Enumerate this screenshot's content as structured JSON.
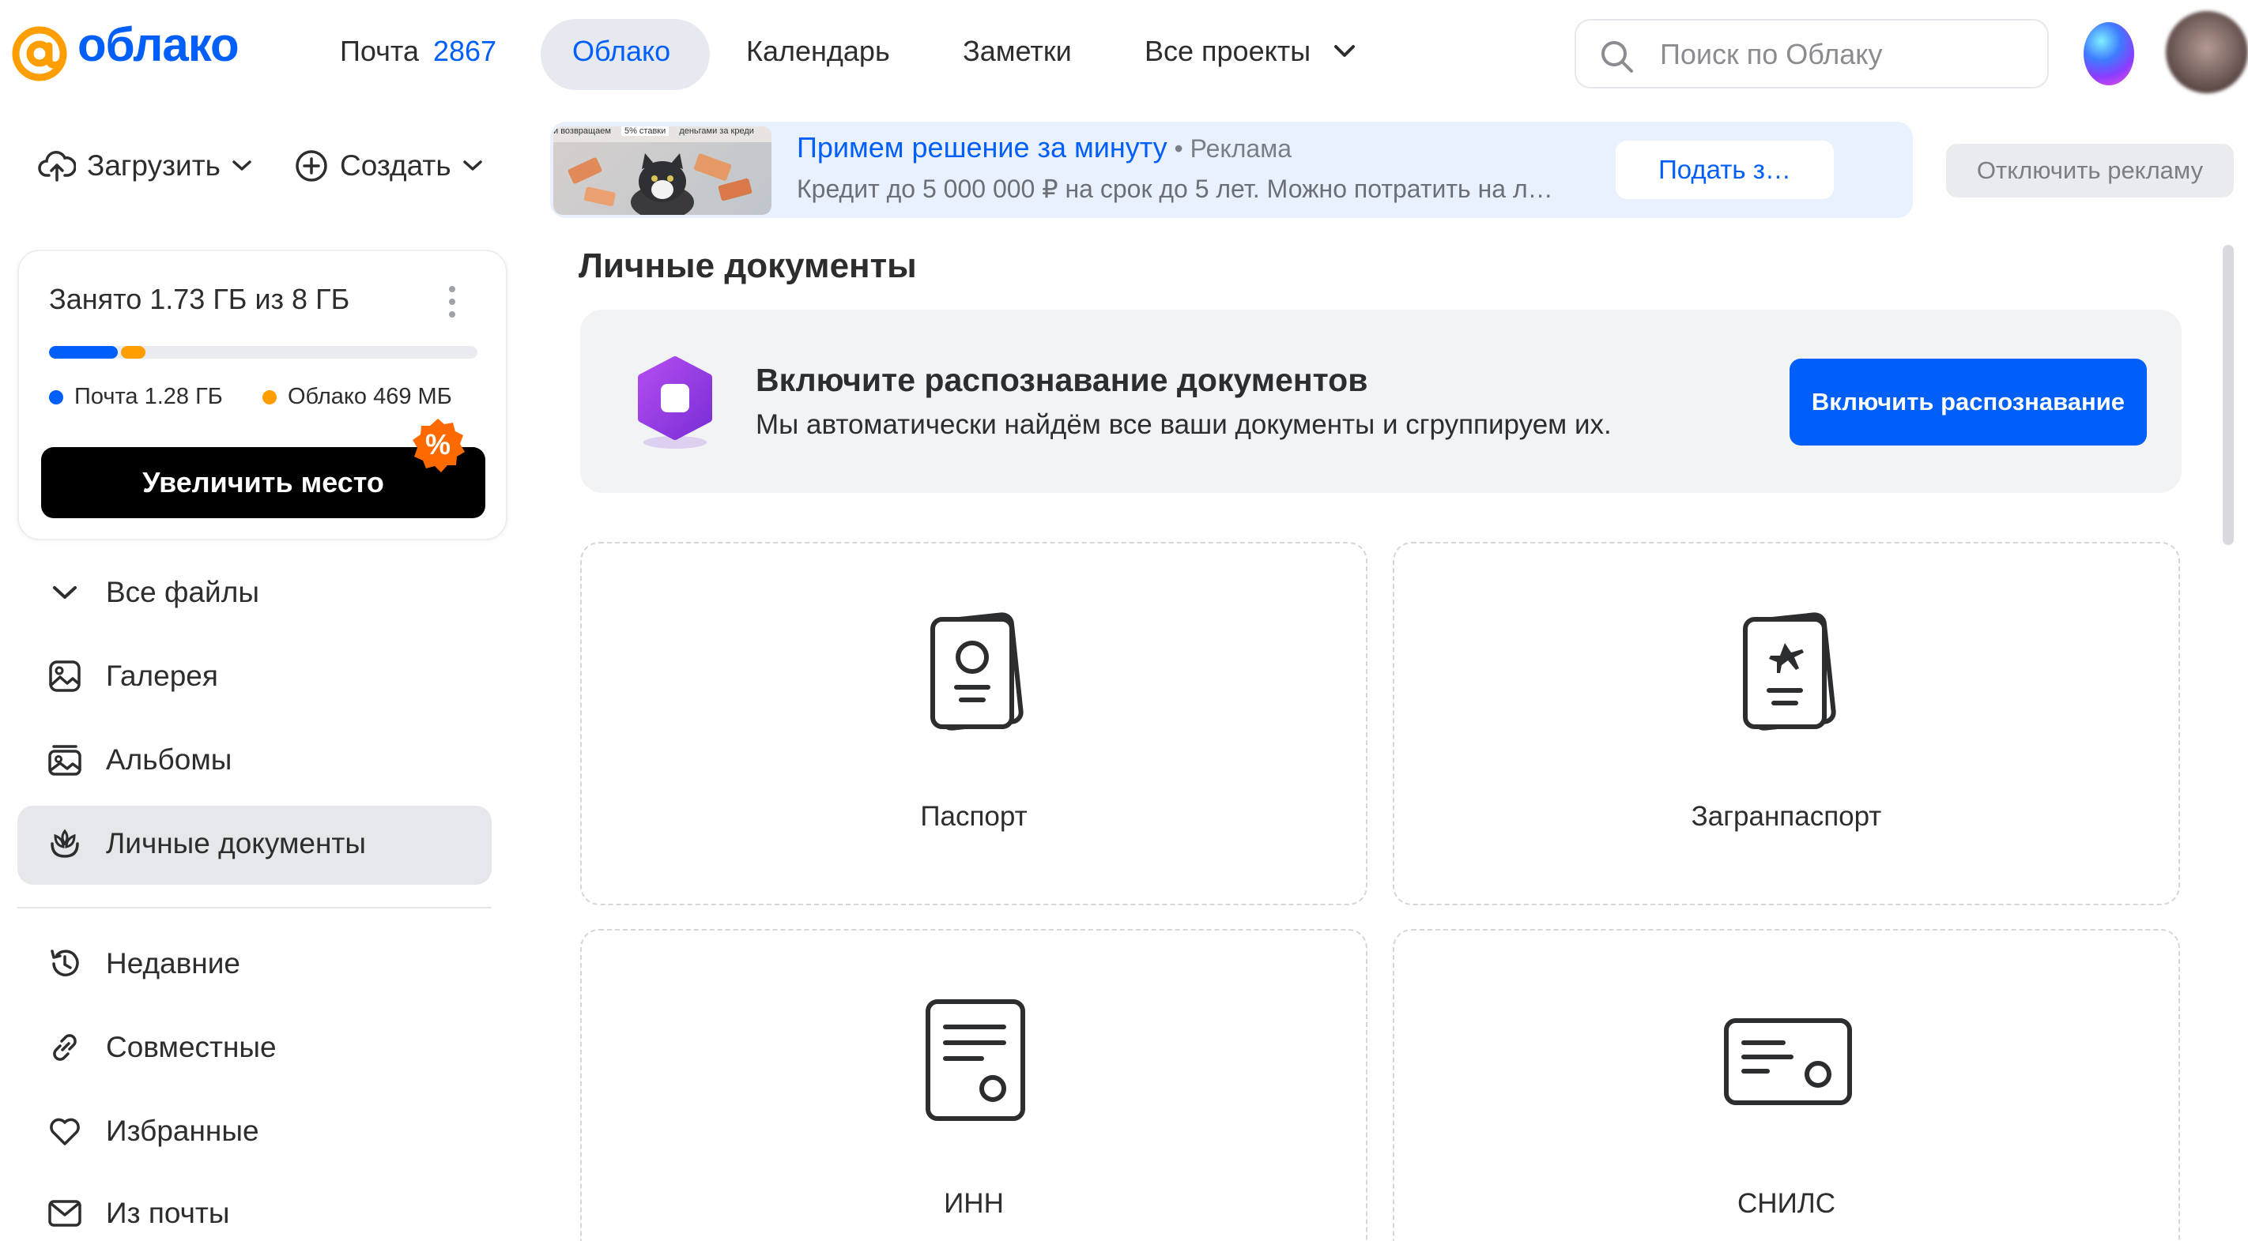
{
  "header": {
    "logo_text": "облако",
    "nav": [
      {
        "label": "Почта",
        "count": "2867"
      },
      {
        "label": "Облако"
      },
      {
        "label": "Календарь"
      },
      {
        "label": "Заметки"
      },
      {
        "label": "Все проекты"
      }
    ],
    "search": {
      "placeholder": "Поиск по Облаку"
    }
  },
  "toolbar": {
    "upload_label": "Загрузить",
    "create_label": "Создать"
  },
  "storage": {
    "title": "Занято 1.73 ГБ из 8 ГБ",
    "mail_fraction": 0.16,
    "cloud_fraction": 0.057,
    "legend": [
      {
        "label": "Почта 1.28 ГБ",
        "color": "#005ff9"
      },
      {
        "label": "Облако 469 МБ",
        "color": "#ff9e00"
      }
    ],
    "increase_label": "Увеличить место",
    "badge_text": "%"
  },
  "sidebar": {
    "items": [
      {
        "label": "Все файлы",
        "icon": "chevron-down-icon"
      },
      {
        "label": "Галерея",
        "icon": "gallery-icon"
      },
      {
        "label": "Альбомы",
        "icon": "albums-icon"
      },
      {
        "label": "Личные документы",
        "icon": "documents-icon",
        "active": true
      },
      {
        "label": "Недавние",
        "icon": "history-icon"
      },
      {
        "label": "Совместные",
        "icon": "link-icon"
      },
      {
        "label": "Избранные",
        "icon": "heart-icon"
      },
      {
        "label": "Из почты",
        "icon": "mail-icon"
      }
    ]
  },
  "ad": {
    "title": "Примем решение за минуту",
    "label": " • Реклама",
    "text": "Кредит до 5 000 000 ₽ на срок до 5 лет. Можно потратить на л…",
    "action": "Подать з…",
    "image_caption_left": "и возвращаем",
    "image_caption_mid": "5% ставки",
    "image_caption_right": "деньгами за креди",
    "disable_label": "Отключить рекламу"
  },
  "main": {
    "title": "Личные документы",
    "promo": {
      "heading": "Включите распознавание документов",
      "subtitle": "Мы автоматически найдём все ваши документы и сгруппируем их.",
      "button": "Включить распознавание"
    },
    "documents": [
      {
        "label": "Паспорт",
        "icon": "passport-icon"
      },
      {
        "label": "Загранпаспорт",
        "icon": "international-passport-icon"
      },
      {
        "label": "ИНН",
        "icon": "inn-document-icon"
      },
      {
        "label": "СНИЛС",
        "icon": "snils-card-icon"
      }
    ]
  },
  "colors": {
    "accent": "#005ff9",
    "orange": "#ff9e00",
    "active_bg": "#e6e7ea"
  }
}
